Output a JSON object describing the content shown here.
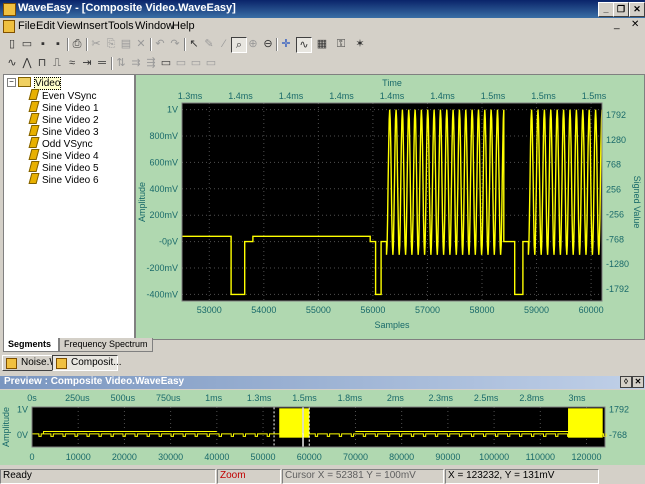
{
  "window": {
    "title": "WaveEasy - [Composite Video.WaveEasy]"
  },
  "menu": [
    "File",
    "Edit",
    "View",
    "Insert",
    "Tools",
    "Window",
    "Help"
  ],
  "tree": {
    "root": "Video",
    "items": [
      "Even VSync",
      "Sine Video 1",
      "Sine Video 2",
      "Sine Video 3",
      "Odd VSync",
      "Sine Video 4",
      "Sine Video 5",
      "Sine Video 6"
    ]
  },
  "plot_tabs": [
    "Segments",
    "Frequency Spectrum"
  ],
  "doc_tabs": [
    "Noise.W...",
    "Composit..."
  ],
  "preview": {
    "title": "Preview : Composite Video.WaveEasy"
  },
  "status": {
    "ready": "Ready",
    "mode": "Zoom",
    "cursor": "Cursor X = 52381 Y = 100mV",
    "position": "X = 123232, Y = 131mV"
  },
  "colors": {
    "plot_bg": "#000000",
    "wave": "#ffff00",
    "panel": "#b0d8b0",
    "axis_text": "#1a6a6a"
  },
  "chart_data": [
    {
      "type": "line",
      "title": "",
      "top_axis_label": "Time",
      "top_ticks": [
        "1.3ms",
        "1.4ms",
        "1.4ms",
        "1.4ms",
        "1.4ms",
        "1.4ms",
        "1.5ms",
        "1.5ms",
        "1.5ms"
      ],
      "xlabel": "Samples",
      "x_ticks": [
        53000,
        54000,
        55000,
        56000,
        57000,
        58000,
        59000,
        60000
      ],
      "xlim": [
        52500,
        60200
      ],
      "ylabel": "Amplitude",
      "y_ticks": [
        "1V",
        "800mV",
        "600mV",
        "400mV",
        "200mV",
        "-0pV",
        "-200mV",
        "-400mV"
      ],
      "ylim": [
        -0.45,
        1.05
      ],
      "y2label": "Signed Value",
      "y2_ticks": [
        "1792",
        "1280",
        "768",
        "256",
        "-256",
        "-768",
        "-1280",
        "-1792"
      ],
      "series": [
        {
          "segments": [
            {
              "kind": "flat",
              "x0": 52500,
              "x1": 53400,
              "y": 0.04
            },
            {
              "kind": "flat",
              "x0": 53400,
              "x1": 53500,
              "y": -0.4
            },
            {
              "kind": "flat",
              "x0": 53500,
              "x1": 53650,
              "y": -0.4
            },
            {
              "kind": "flat",
              "x0": 53650,
              "x1": 53800,
              "y": 0.0
            },
            {
              "kind": "flat",
              "x0": 53800,
              "x1": 55950,
              "y": 0.04
            },
            {
              "kind": "flat",
              "x0": 55950,
              "x1": 56050,
              "y": 0.0
            },
            {
              "kind": "flat",
              "x0": 56050,
              "x1": 56150,
              "y": -0.4
            },
            {
              "kind": "flat",
              "x0": 56150,
              "x1": 56250,
              "y": 0.0
            },
            {
              "kind": "sine",
              "x0": 56250,
              "x1": 58400,
              "center": 0.45,
              "amp": 0.55,
              "cycles": 18.5
            },
            {
              "kind": "flat",
              "x0": 58400,
              "x1": 58600,
              "y": 0.0
            },
            {
              "kind": "flat",
              "x0": 58600,
              "x1": 58750,
              "y": -0.4
            },
            {
              "kind": "flat",
              "x0": 58750,
              "x1": 58850,
              "y": 0.0
            },
            {
              "kind": "sine",
              "x0": 58850,
              "x1": 60200,
              "center": 0.45,
              "amp": 0.55,
              "cycles": 11.5
            }
          ]
        }
      ]
    },
    {
      "type": "line",
      "top_ticks": [
        "0s",
        "250us",
        "500us",
        "750us",
        "1ms",
        "1.3ms",
        "1.5ms",
        "1.8ms",
        "2ms",
        "2.3ms",
        "2.5ms",
        "2.8ms",
        "3ms"
      ],
      "x_ticks": [
        0,
        10000,
        20000,
        30000,
        40000,
        50000,
        60000,
        70000,
        80000,
        90000,
        100000,
        110000,
        120000
      ],
      "xlim": [
        0,
        124000
      ],
      "ylabel": "Amplitude",
      "y_ticks": [
        "1V",
        "0V"
      ],
      "y2_ticks": [
        "1792",
        "-768"
      ],
      "ylim": [
        -0.45,
        1.05
      ],
      "burst_ranges": [
        [
          53500,
          58500
        ],
        [
          58800,
          60000
        ],
        [
          116000,
          123500
        ]
      ],
      "selection": [
        52381,
        60000
      ]
    }
  ]
}
